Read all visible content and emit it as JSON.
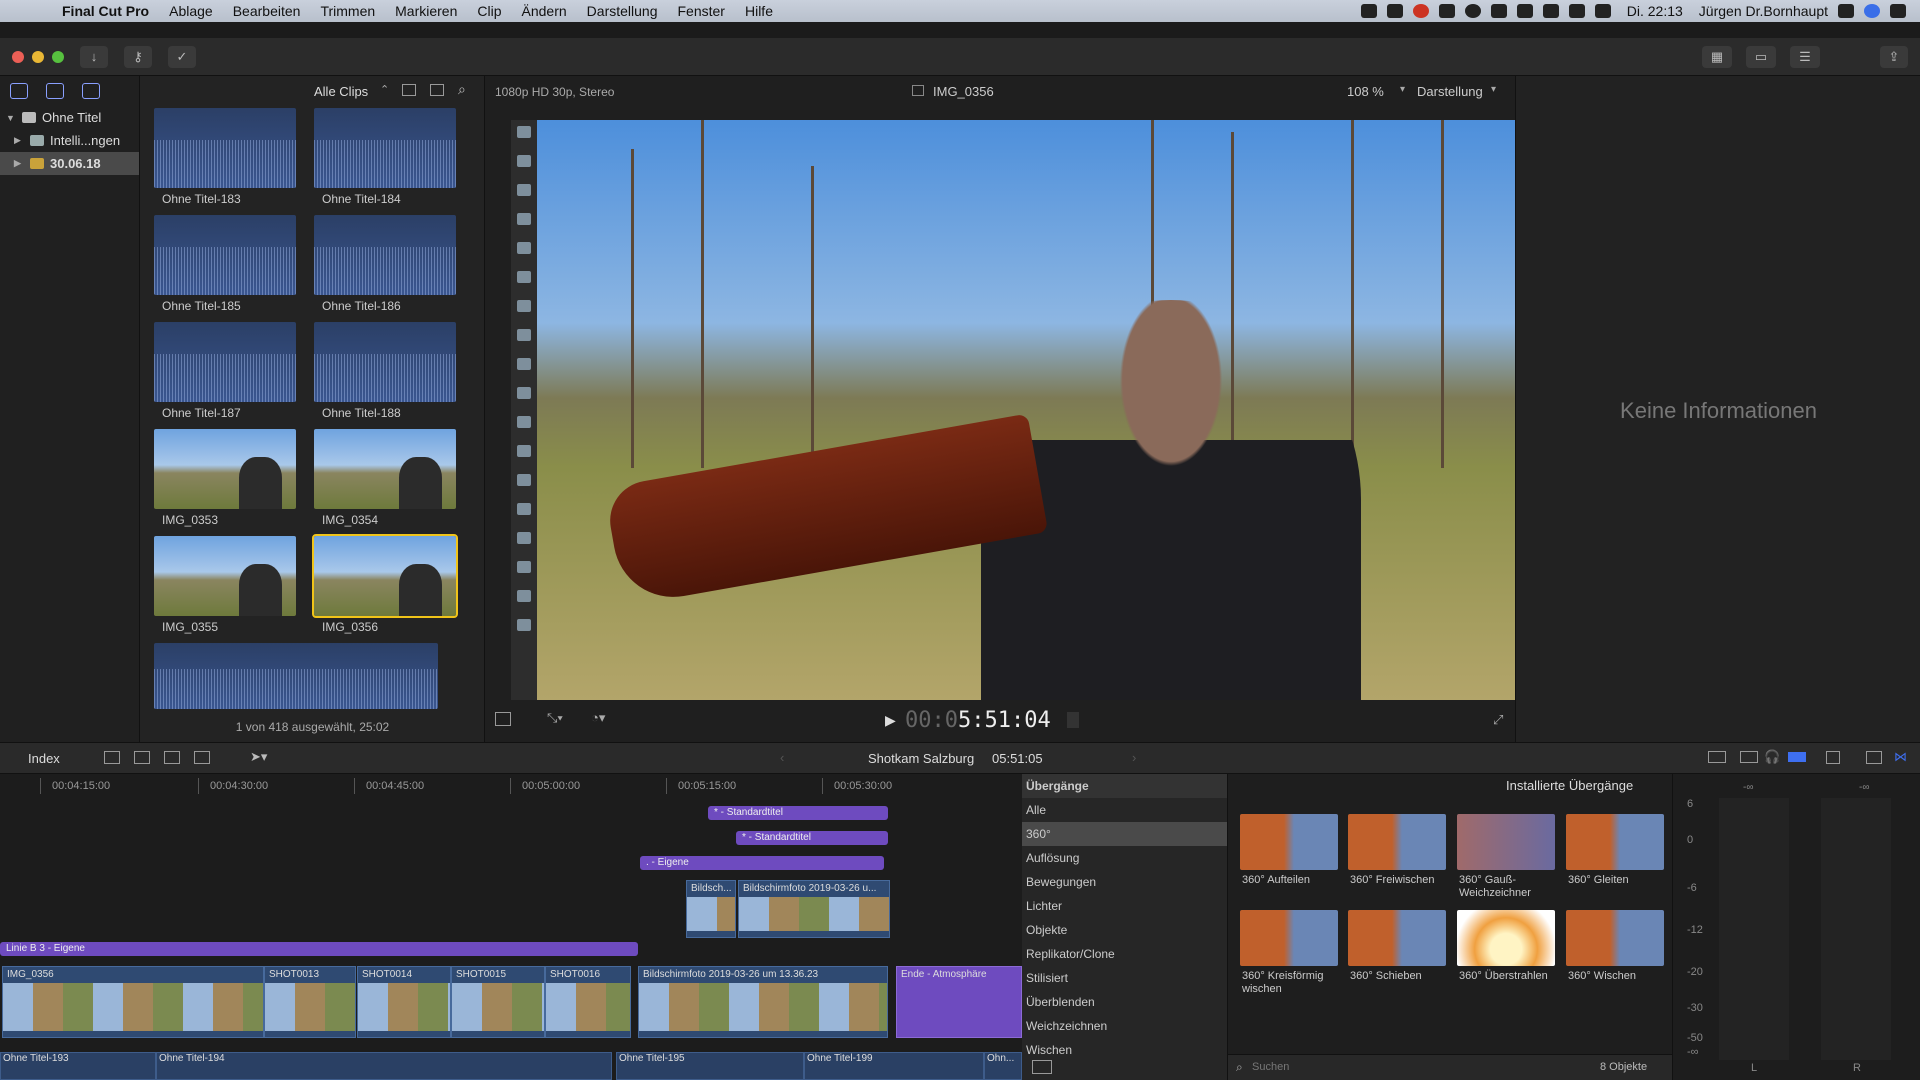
{
  "menubar": {
    "app": "Final Cut Pro",
    "items": [
      "Ablage",
      "Bearbeiten",
      "Trimmen",
      "Markieren",
      "Clip",
      "Ändern",
      "Darstellung",
      "Fenster",
      "Hilfe"
    ],
    "clock": "Di. 22:13",
    "user": "Jürgen Dr.Bornhaupt"
  },
  "library": {
    "rows": [
      {
        "label": "Ohne Titel"
      },
      {
        "label": "Intelli...ngen"
      },
      {
        "label": "30.06.18"
      }
    ]
  },
  "browser": {
    "filter": "Alle Clips",
    "clips": [
      {
        "label": "Ohne Titel-183",
        "kind": "wave"
      },
      {
        "label": "Ohne Titel-184",
        "kind": "wave"
      },
      {
        "label": "Ohne Titel-185",
        "kind": "wave"
      },
      {
        "label": "Ohne Titel-186",
        "kind": "wave"
      },
      {
        "label": "Ohne Titel-187",
        "kind": "wave"
      },
      {
        "label": "Ohne Titel-188",
        "kind": "wave"
      },
      {
        "label": "IMG_0353",
        "kind": "photo"
      },
      {
        "label": "IMG_0354",
        "kind": "photo"
      },
      {
        "label": "IMG_0355",
        "kind": "photo"
      },
      {
        "label": "IMG_0356",
        "kind": "photo"
      }
    ],
    "status": "1 von 418 ausgewählt, 25:02"
  },
  "viewer": {
    "format": "1080p HD 30p, Stereo",
    "clip_name": "IMG_0356",
    "zoom": "108 %",
    "view_menu": "Darstellung",
    "timecode_dim": "00:0",
    "timecode": "5:51:04"
  },
  "inspector": {
    "empty_text": "Keine Informationen"
  },
  "timeline_bar": {
    "index": "Index",
    "project": "Shotkam Salzburg",
    "duration": "05:51:05"
  },
  "timeline": {
    "ruler": [
      "00:04:15:00",
      "00:04:30:00",
      "00:04:45:00",
      "00:05:00:00",
      "00:05:15:00",
      "00:05:30:00"
    ],
    "titles": [
      "* - Standardtitel",
      "* - Standardtitel",
      ". - Eigene",
      "Linie B 3 - Eigene"
    ],
    "upper_clips": [
      "Bildsch...",
      "Bildschirmfoto 2019-03-26 u..."
    ],
    "video_clips": [
      "IMG_0356",
      "SHOT0013",
      "SHOT0014",
      "SHOT0015",
      "SHOT0016",
      "Bildschirmfoto 2019-03-26 um 13.36.23",
      "Ende - Atmosphäre"
    ],
    "audio_clips": [
      "Ohne Titel-193",
      "Ohne Titel-194",
      "Ohne Titel-195",
      "Ohne Titel-199",
      "Ohn..."
    ]
  },
  "transitions": {
    "header": "Übergänge",
    "installed": "Installierte Übergänge",
    "categories": [
      "Alle",
      "360°",
      "Auflösung",
      "Bewegungen",
      "Lichter",
      "Objekte",
      "Replikator/Clone",
      "Stilisiert",
      "Überblenden",
      "Weichzeichnen",
      "Wischen"
    ],
    "items": [
      "360° Aufteilen",
      "360° Freiwischen",
      "360° Gauß-Weichzeichner",
      "360° Gleiten",
      "360° Kreisförmig wischen",
      "360° Schieben",
      "360° Überstrahlen",
      "360° Wischen"
    ],
    "search_placeholder": "Suchen",
    "count": "8 Objekte"
  },
  "meters": {
    "scale": [
      "6",
      "0",
      "-6",
      "-12",
      "-20",
      "-30",
      "-50",
      "-∞"
    ],
    "peak_left": "-∞",
    "peak_right": "-∞",
    "left": "L",
    "right": "R"
  }
}
